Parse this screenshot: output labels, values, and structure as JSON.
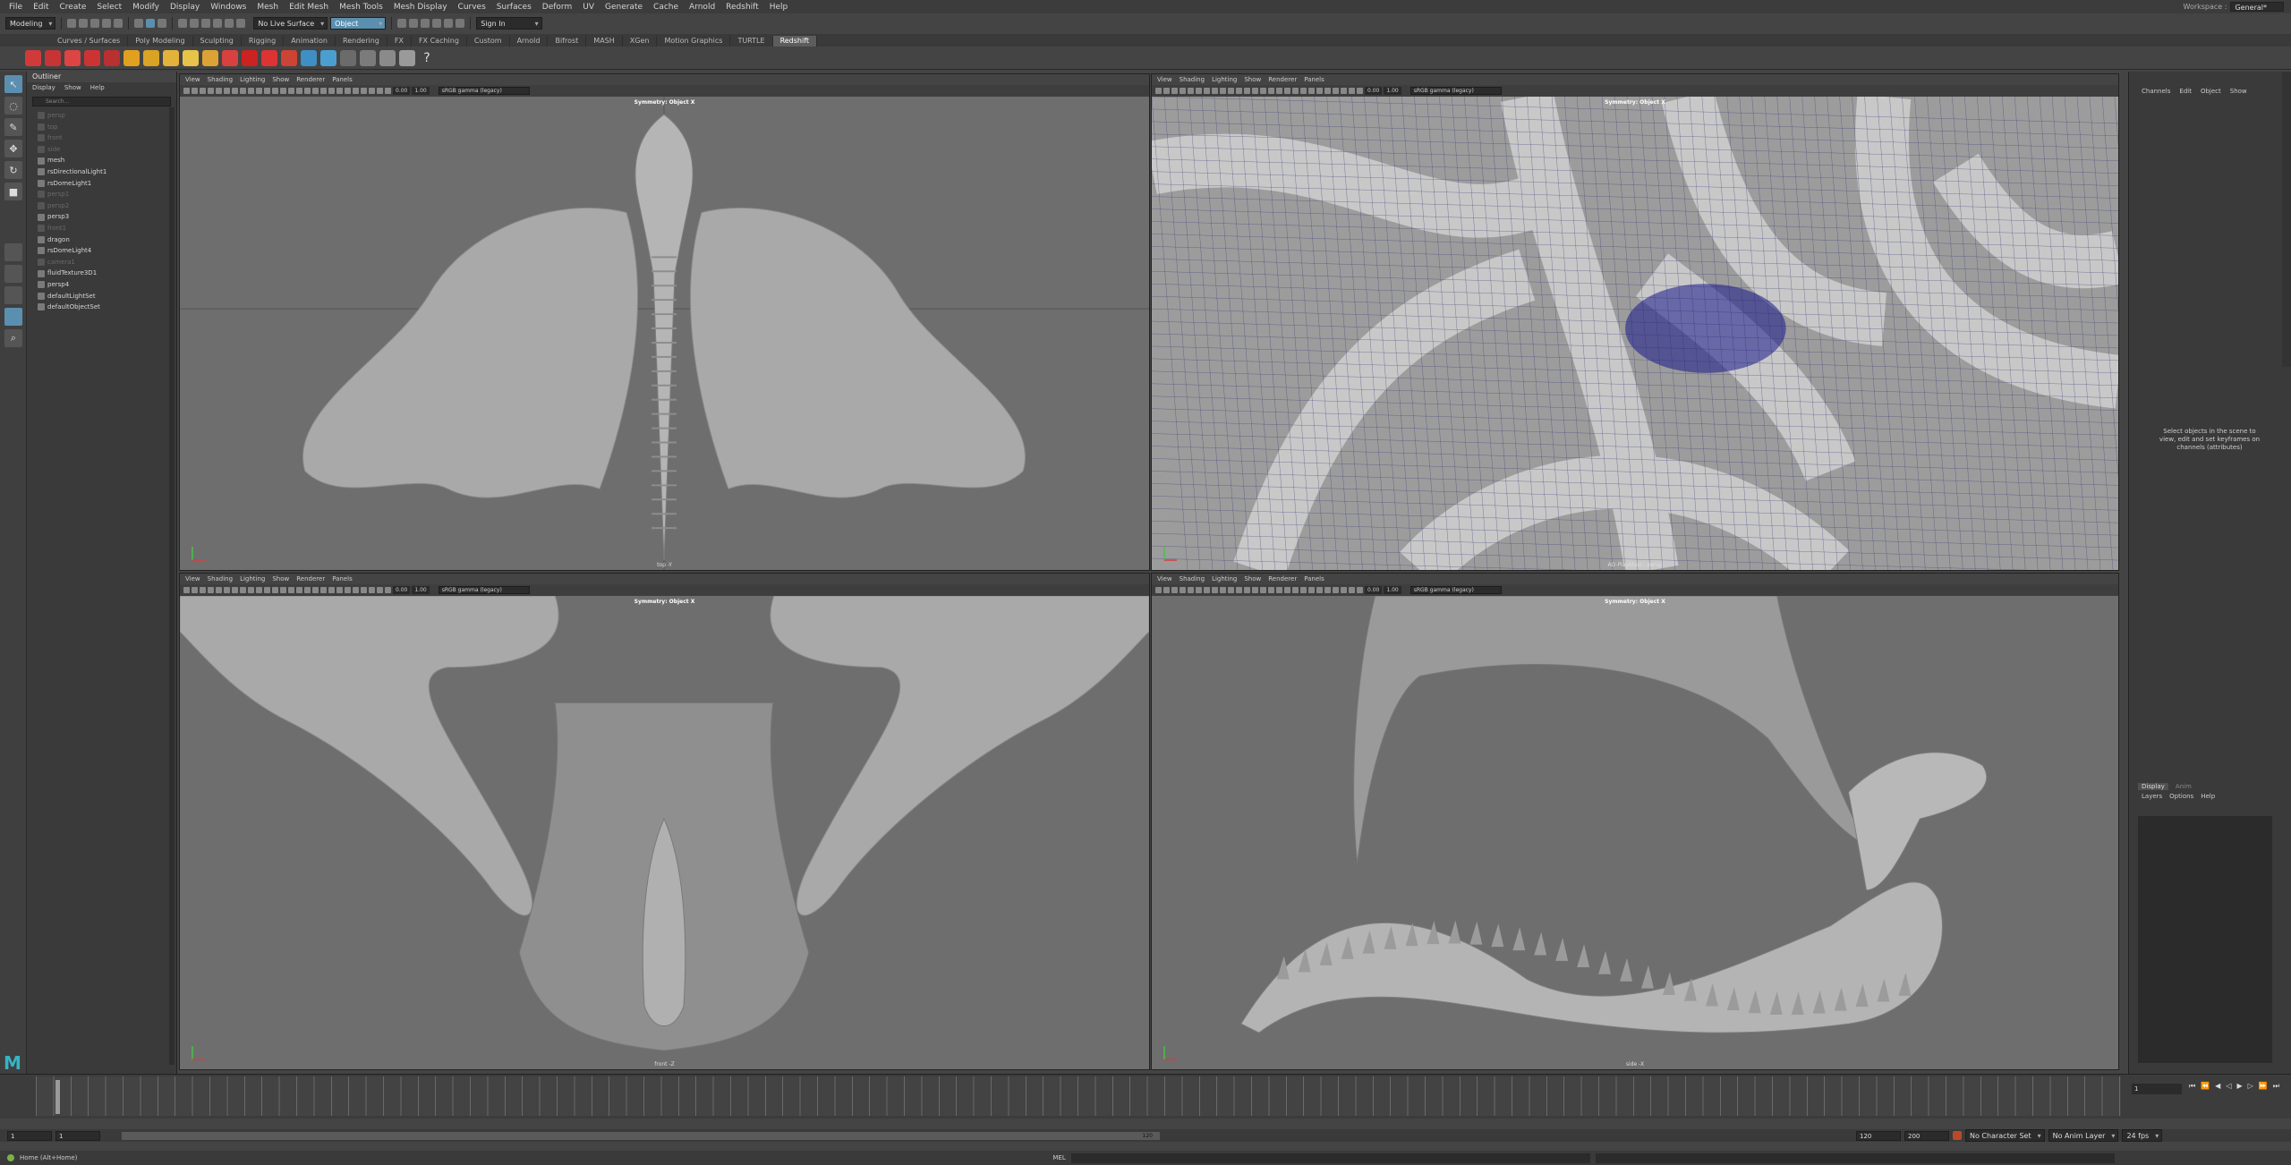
{
  "menus": [
    "File",
    "Edit",
    "Create",
    "Select",
    "Modify",
    "Display",
    "Windows",
    "Mesh",
    "Edit Mesh",
    "Mesh Tools",
    "Mesh Display",
    "Curves",
    "Surfaces",
    "Deform",
    "UV",
    "Generate",
    "Cache",
    "Arnold",
    "Redshift",
    "Help"
  ],
  "workspace": {
    "label": "Workspace :",
    "value": "General*"
  },
  "status": {
    "mode": "Modeling",
    "surface": "No Live Surface",
    "object": "Object",
    "signin": "Sign In"
  },
  "shelf_tabs": [
    "Curves / Surfaces",
    "Poly Modeling",
    "Sculpting",
    "Rigging",
    "Animation",
    "Rendering",
    "FX",
    "FX Caching",
    "Custom",
    "Arnold",
    "Bifrost",
    "MASH",
    "XGen",
    "Motion Graphics",
    "TURTLE",
    "Redshift"
  ],
  "shelf_active": "Redshift",
  "outliner": {
    "title": "Outliner",
    "menu": [
      "Display",
      "Show",
      "Help"
    ],
    "search": "Search...",
    "items": [
      {
        "label": "persp",
        "dim": true
      },
      {
        "label": "top",
        "dim": true
      },
      {
        "label": "front",
        "dim": true
      },
      {
        "label": "side",
        "dim": true
      },
      {
        "label": "mesh",
        "dim": false
      },
      {
        "label": "rsDirectionalLight1",
        "dim": false
      },
      {
        "label": "rsDomeLight1",
        "dim": false
      },
      {
        "label": "persp1",
        "dim": true
      },
      {
        "label": "persp2",
        "dim": true
      },
      {
        "label": "persp3",
        "dim": false
      },
      {
        "label": "front1",
        "dim": true
      },
      {
        "label": "dragon",
        "dim": false
      },
      {
        "label": "rsDomeLight4",
        "dim": false
      },
      {
        "label": "camera1",
        "dim": true
      },
      {
        "label": "fluidTexture3D1",
        "dim": false
      },
      {
        "label": "persp4",
        "dim": false
      },
      {
        "label": "defaultLightSet",
        "dim": false
      },
      {
        "label": "defaultObjectSet",
        "dim": false
      }
    ]
  },
  "viewport_menu": [
    "View",
    "Shading",
    "Lighting",
    "Show",
    "Renderer",
    "Panels"
  ],
  "viewports": [
    {
      "sym": "Symmetry: Object X",
      "cam": "top -Y",
      "colorspace": "sRGB gamma (legacy)",
      "exposure": "0.00",
      "gamma": "1.00",
      "kind": "top"
    },
    {
      "sym": "Symmetry: Object X",
      "cam": "AO-Playblast - persp",
      "colorspace": "sRGB gamma (legacy)",
      "exposure": "0.00",
      "gamma": "1.00",
      "kind": "wire"
    },
    {
      "sym": "Symmetry: Object X",
      "cam": "front -Z",
      "colorspace": "sRGB gamma (legacy)",
      "exposure": "0.00",
      "gamma": "1.00",
      "kind": "front"
    },
    {
      "sym": "Symmetry: Object X",
      "cam": "side -X",
      "colorspace": "sRGB gamma (legacy)",
      "exposure": "0.00",
      "gamma": "1.00",
      "kind": "side"
    }
  ],
  "channelbox": {
    "menu": [
      "Channels",
      "Edit",
      "Object",
      "Show"
    ],
    "hint": "Select objects in the scene to view, edit and set keyframes on channels (attributes)",
    "layer_tabs": [
      "Display",
      "Anim"
    ],
    "layer_menu": [
      "Layers",
      "Options",
      "Help"
    ]
  },
  "timeline": {
    "current": "1",
    "start": "1",
    "end": "120",
    "range_start": "1",
    "range_end": "120",
    "anim_end": "200",
    "range_label": "120"
  },
  "bottom": {
    "char_set": "No Character Set",
    "anim_layer": "No Anim Layer",
    "fps": "24 fps"
  },
  "cmdline": {
    "help": "Home (Alt+Home)",
    "mel": "MEL"
  },
  "colors": {
    "accent": "#5b8fb0",
    "logo": "#37b3c6",
    "wire": "#1a1a8a"
  }
}
